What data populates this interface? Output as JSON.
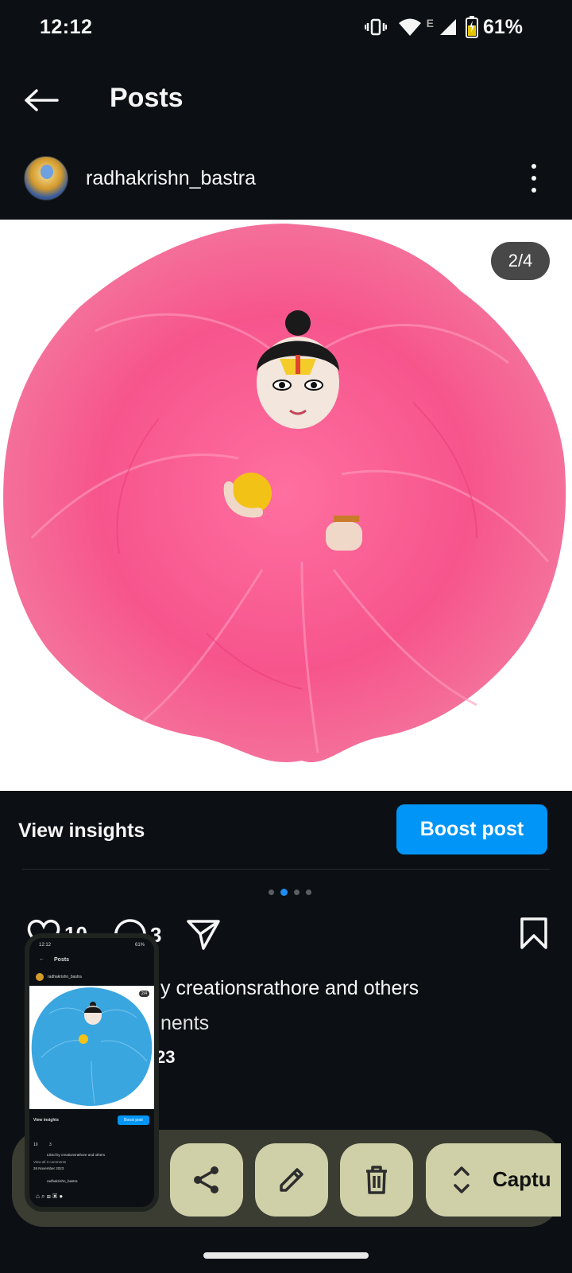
{
  "status_bar": {
    "time": "12:12",
    "network_label": "E",
    "battery": "61%",
    "icons": [
      "vibrate-icon",
      "wifi-icon",
      "signal-icon",
      "battery-icon"
    ]
  },
  "appbar": {
    "title": "Posts",
    "back_icon": "arrow-left-icon"
  },
  "post": {
    "username": "radhakrishn_bastra",
    "image_counter": "2/4",
    "carousel": {
      "total": 4,
      "active_index": 1
    },
    "view_insights_label": "View insights",
    "boost_label": "Boost post",
    "likes_count": "10",
    "comments_count": "3",
    "liked_by_text": "y creationsrathore and others",
    "comments_text": "nents",
    "date_text": "23"
  },
  "toolbar": {
    "capture_label": "Captu",
    "buttons": [
      "share-icon",
      "edit-icon",
      "delete-icon",
      "expand-icon"
    ]
  },
  "thumbnail": {
    "time": "12:12",
    "battery": "61%",
    "title": "Posts",
    "username": "radhakrishn_bastra",
    "counter": "2/4",
    "view_insights_label": "View insights",
    "boost_label": "Boost post",
    "likes_count": "10",
    "comments_count": "3",
    "liked_by_text": "Liked by creationsrathore and others",
    "comments_text": "View all 3 comments",
    "date_text": "26 November 2023",
    "username_2": "radhakrishn_bastra"
  },
  "colors": {
    "background": "#0c1014",
    "accent": "#0095f6",
    "fur_main": "#f7548c",
    "thumb_fur": "#3aa6e0",
    "toolbar_bg": "#3b3d33",
    "toolbar_btn": "#cfd0a8"
  }
}
